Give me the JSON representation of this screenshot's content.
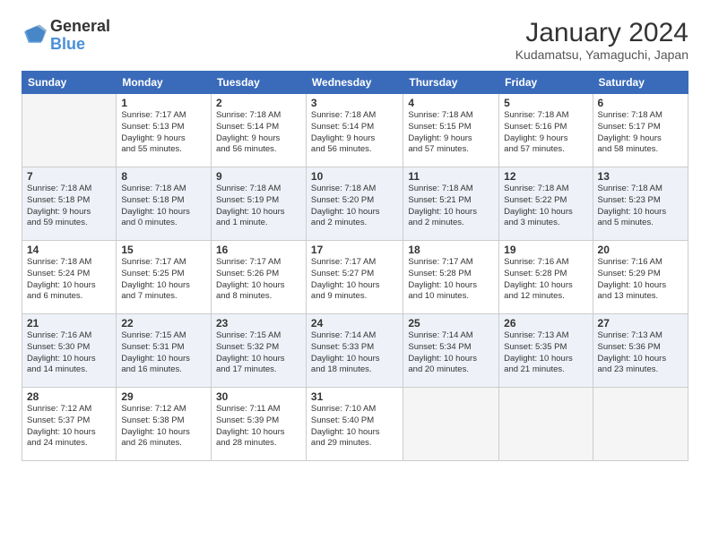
{
  "logo": {
    "line1": "General",
    "line2": "Blue"
  },
  "calendar": {
    "title": "January 2024",
    "subtitle": "Kudamatsu, Yamaguchi, Japan",
    "headers": [
      "Sunday",
      "Monday",
      "Tuesday",
      "Wednesday",
      "Thursday",
      "Friday",
      "Saturday"
    ],
    "rows": [
      [
        {
          "day": "",
          "info": ""
        },
        {
          "day": "1",
          "info": "Sunrise: 7:17 AM\nSunset: 5:13 PM\nDaylight: 9 hours\nand 55 minutes."
        },
        {
          "day": "2",
          "info": "Sunrise: 7:18 AM\nSunset: 5:14 PM\nDaylight: 9 hours\nand 56 minutes."
        },
        {
          "day": "3",
          "info": "Sunrise: 7:18 AM\nSunset: 5:14 PM\nDaylight: 9 hours\nand 56 minutes."
        },
        {
          "day": "4",
          "info": "Sunrise: 7:18 AM\nSunset: 5:15 PM\nDaylight: 9 hours\nand 57 minutes."
        },
        {
          "day": "5",
          "info": "Sunrise: 7:18 AM\nSunset: 5:16 PM\nDaylight: 9 hours\nand 57 minutes."
        },
        {
          "day": "6",
          "info": "Sunrise: 7:18 AM\nSunset: 5:17 PM\nDaylight: 9 hours\nand 58 minutes."
        }
      ],
      [
        {
          "day": "7",
          "info": "Sunrise: 7:18 AM\nSunset: 5:18 PM\nDaylight: 9 hours\nand 59 minutes."
        },
        {
          "day": "8",
          "info": "Sunrise: 7:18 AM\nSunset: 5:18 PM\nDaylight: 10 hours\nand 0 minutes."
        },
        {
          "day": "9",
          "info": "Sunrise: 7:18 AM\nSunset: 5:19 PM\nDaylight: 10 hours\nand 1 minute."
        },
        {
          "day": "10",
          "info": "Sunrise: 7:18 AM\nSunset: 5:20 PM\nDaylight: 10 hours\nand 2 minutes."
        },
        {
          "day": "11",
          "info": "Sunrise: 7:18 AM\nSunset: 5:21 PM\nDaylight: 10 hours\nand 2 minutes."
        },
        {
          "day": "12",
          "info": "Sunrise: 7:18 AM\nSunset: 5:22 PM\nDaylight: 10 hours\nand 3 minutes."
        },
        {
          "day": "13",
          "info": "Sunrise: 7:18 AM\nSunset: 5:23 PM\nDaylight: 10 hours\nand 5 minutes."
        }
      ],
      [
        {
          "day": "14",
          "info": "Sunrise: 7:18 AM\nSunset: 5:24 PM\nDaylight: 10 hours\nand 6 minutes."
        },
        {
          "day": "15",
          "info": "Sunrise: 7:17 AM\nSunset: 5:25 PM\nDaylight: 10 hours\nand 7 minutes."
        },
        {
          "day": "16",
          "info": "Sunrise: 7:17 AM\nSunset: 5:26 PM\nDaylight: 10 hours\nand 8 minutes."
        },
        {
          "day": "17",
          "info": "Sunrise: 7:17 AM\nSunset: 5:27 PM\nDaylight: 10 hours\nand 9 minutes."
        },
        {
          "day": "18",
          "info": "Sunrise: 7:17 AM\nSunset: 5:28 PM\nDaylight: 10 hours\nand 10 minutes."
        },
        {
          "day": "19",
          "info": "Sunrise: 7:16 AM\nSunset: 5:28 PM\nDaylight: 10 hours\nand 12 minutes."
        },
        {
          "day": "20",
          "info": "Sunrise: 7:16 AM\nSunset: 5:29 PM\nDaylight: 10 hours\nand 13 minutes."
        }
      ],
      [
        {
          "day": "21",
          "info": "Sunrise: 7:16 AM\nSunset: 5:30 PM\nDaylight: 10 hours\nand 14 minutes."
        },
        {
          "day": "22",
          "info": "Sunrise: 7:15 AM\nSunset: 5:31 PM\nDaylight: 10 hours\nand 16 minutes."
        },
        {
          "day": "23",
          "info": "Sunrise: 7:15 AM\nSunset: 5:32 PM\nDaylight: 10 hours\nand 17 minutes."
        },
        {
          "day": "24",
          "info": "Sunrise: 7:14 AM\nSunset: 5:33 PM\nDaylight: 10 hours\nand 18 minutes."
        },
        {
          "day": "25",
          "info": "Sunrise: 7:14 AM\nSunset: 5:34 PM\nDaylight: 10 hours\nand 20 minutes."
        },
        {
          "day": "26",
          "info": "Sunrise: 7:13 AM\nSunset: 5:35 PM\nDaylight: 10 hours\nand 21 minutes."
        },
        {
          "day": "27",
          "info": "Sunrise: 7:13 AM\nSunset: 5:36 PM\nDaylight: 10 hours\nand 23 minutes."
        }
      ],
      [
        {
          "day": "28",
          "info": "Sunrise: 7:12 AM\nSunset: 5:37 PM\nDaylight: 10 hours\nand 24 minutes."
        },
        {
          "day": "29",
          "info": "Sunrise: 7:12 AM\nSunset: 5:38 PM\nDaylight: 10 hours\nand 26 minutes."
        },
        {
          "day": "30",
          "info": "Sunrise: 7:11 AM\nSunset: 5:39 PM\nDaylight: 10 hours\nand 28 minutes."
        },
        {
          "day": "31",
          "info": "Sunrise: 7:10 AM\nSunset: 5:40 PM\nDaylight: 10 hours\nand 29 minutes."
        },
        {
          "day": "",
          "info": ""
        },
        {
          "day": "",
          "info": ""
        },
        {
          "day": "",
          "info": ""
        }
      ]
    ]
  }
}
